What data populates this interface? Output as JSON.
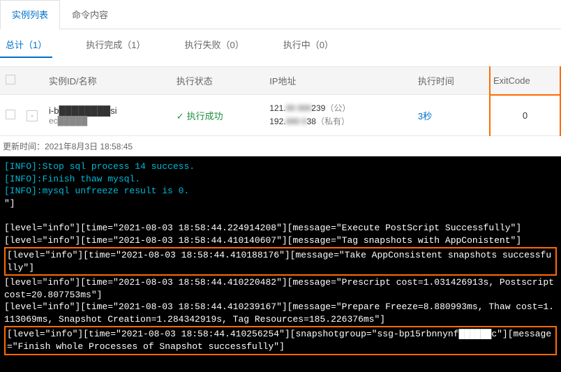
{
  "tabs": {
    "list": "实例列表",
    "cmd": "命令内容"
  },
  "filters": {
    "total": "总计（1）",
    "done": "执行完成（1）",
    "fail": "执行失败（0）",
    "running": "执行中（0）"
  },
  "headers": {
    "instance": "实例ID/名称",
    "status": "执行状态",
    "ip": "IP地址",
    "time": "执行时间",
    "exit": "ExitCode"
  },
  "row": {
    "name": "i-b████████si",
    "sub": "ec█████",
    "status": "执行成功",
    "ip_pub_a": "121.",
    "ip_pub_b": "239",
    "ip_pub_tag": "（公）",
    "ip_priv_a": "192.",
    "ip_priv_b": "38",
    "ip_priv_tag": "（私有）",
    "time": "3秒",
    "exit": "0"
  },
  "update_time": "更新时间：2021年8月3日 18:58:45",
  "console": {
    "l1": "[INFO]:Stop sql process 14 success.",
    "l2": "[INFO]:Finish thaw mysql.",
    "l3": "[INFO]:mysql unfreeze result is 0.",
    "l4": "\"]",
    "l5": "[level=\"info\"][time=\"2021-08-03 18:58:44.224914208\"][message=\"Execute PostScript Successfully\"]",
    "l6": "[level=\"info\"][time=\"2021-08-03 18:58:44.410140607\"][message=\"Tag snapshots with AppConistent\"]",
    "l7": "[level=\"info\"][time=\"2021-08-03 18:58:44.410188176\"][message=\"Take AppConsistent snapshots successfully\"]",
    "l8": "[level=\"info\"][time=\"2021-08-03 18:58:44.410220482\"][message=\"Prescript cost=1.031426913s, Postscript cost=20.807753ms\"]",
    "l9": "[level=\"info\"][time=\"2021-08-03 18:58:44.410239167\"][message=\"Prepare Freeze=8.880993ms, Thaw cost=1.113069ms, Snapshot Creation=1.284342919s, Tag Resources=185.226376ms\"]",
    "l10": "[level=\"info\"][time=\"2021-08-03 18:58:44.410256254\"][snapshotgroup=\"ssg-bp15rbnnynf██████c\"][message=\"Finish whole Processes of Snapshot successfully\"]"
  }
}
